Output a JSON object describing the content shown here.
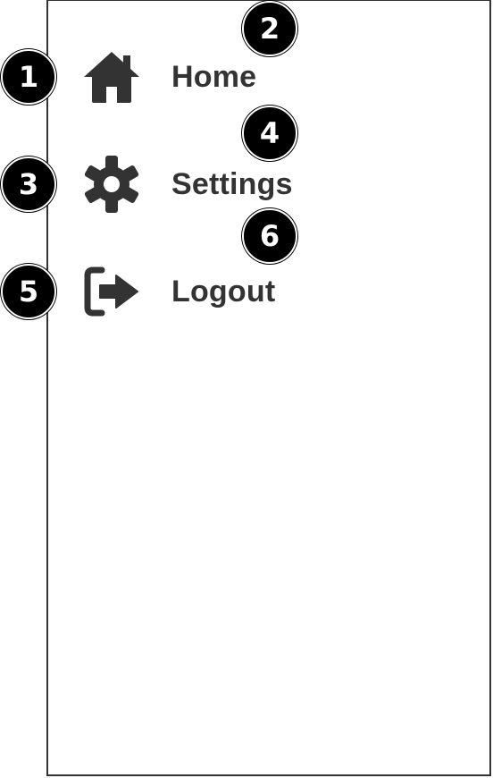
{
  "menu": {
    "items": [
      {
        "label": "Home",
        "icon": "home-icon"
      },
      {
        "label": "Settings",
        "icon": "gear-icon"
      },
      {
        "label": "Logout",
        "icon": "logout-icon"
      }
    ]
  },
  "markers": [
    "1",
    "2",
    "3",
    "4",
    "5",
    "6"
  ],
  "colors": {
    "text": "#333333",
    "icon": "#333333",
    "border": "#333333",
    "marker_bg": "#000000",
    "marker_text": "#ffffff",
    "background": "#ffffff"
  }
}
